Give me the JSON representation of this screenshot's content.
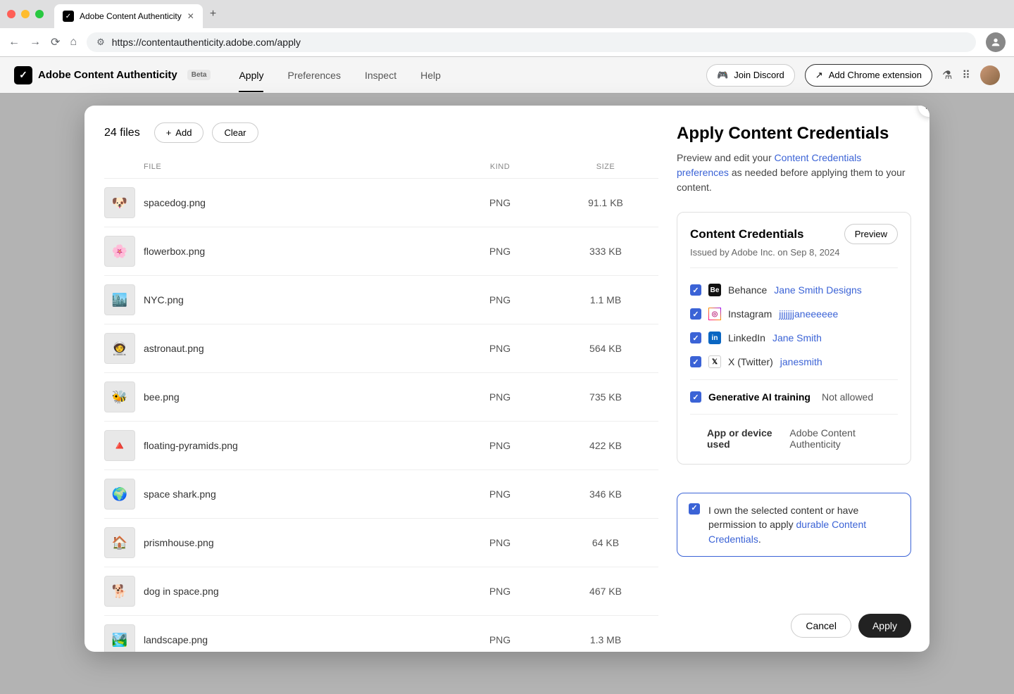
{
  "browser": {
    "tab_title": "Adobe Content Authenticity",
    "url": "https://contentauthenticity.adobe.com/apply"
  },
  "header": {
    "app_name": "Adobe Content Authenticity",
    "beta_label": "Beta",
    "nav": [
      "Apply",
      "Preferences",
      "Inspect",
      "Help"
    ],
    "active_nav": "Apply",
    "discord_label": "Join Discord",
    "extension_label": "Add Chrome extension"
  },
  "left": {
    "file_count_label": "24 files",
    "add_label": "Add",
    "clear_label": "Clear",
    "columns": {
      "file": "FILE",
      "kind": "KIND",
      "size": "SIZE"
    },
    "files": [
      {
        "name": "spacedog.png",
        "kind": "PNG",
        "size": "91.1 KB",
        "thumb": "🐶"
      },
      {
        "name": "flowerbox.png",
        "kind": "PNG",
        "size": "333 KB",
        "thumb": "🌸"
      },
      {
        "name": "NYC.png",
        "kind": "PNG",
        "size": "1.1 MB",
        "thumb": "🏙️"
      },
      {
        "name": "astronaut.png",
        "kind": "PNG",
        "size": "564 KB",
        "thumb": "🧑‍🚀"
      },
      {
        "name": "bee.png",
        "kind": "PNG",
        "size": "735 KB",
        "thumb": "🐝"
      },
      {
        "name": "floating-pyramids.png",
        "kind": "PNG",
        "size": "422 KB",
        "thumb": "🔺"
      },
      {
        "name": "space shark.png",
        "kind": "PNG",
        "size": "346 KB",
        "thumb": "🌍"
      },
      {
        "name": "prismhouse.png",
        "kind": "PNG",
        "size": "64 KB",
        "thumb": "🏠"
      },
      {
        "name": "dog in space.png",
        "kind": "PNG",
        "size": "467 KB",
        "thumb": "🐕"
      },
      {
        "name": "landscape.png",
        "kind": "PNG",
        "size": "1.3 MB",
        "thumb": "🏞️"
      }
    ]
  },
  "right": {
    "title": "Apply Content Credentials",
    "desc_prefix": "Preview and edit your ",
    "desc_link": "Content Credentials preferences",
    "desc_suffix": " as needed before applying them to your content.",
    "card_title": "Content Credentials",
    "preview_label": "Preview",
    "issued_by": "Issued by Adobe Inc. on Sep 8, 2024",
    "socials": [
      {
        "platform": "Behance",
        "handle": "Jane Smith Designs",
        "icon": "Be",
        "cls": "si-behance"
      },
      {
        "platform": "Instagram",
        "handle": "jjjjjjjaneeeeee",
        "icon": "◎",
        "cls": "si-instagram"
      },
      {
        "platform": "LinkedIn",
        "handle": "Jane Smith",
        "icon": "in",
        "cls": "si-linkedin"
      },
      {
        "platform": "X (Twitter)",
        "handle": "janesmith",
        "icon": "𝕏",
        "cls": "si-x"
      }
    ],
    "genai_label": "Generative AI training",
    "genai_value": "Not allowed",
    "app_used_label": "App or device used",
    "app_used_value": "Adobe Content Authenticity",
    "consent_prefix": "I own the selected content or have permission to apply ",
    "consent_link": "durable Content Credentials",
    "consent_suffix": ".",
    "cancel_label": "Cancel",
    "apply_label": "Apply"
  }
}
